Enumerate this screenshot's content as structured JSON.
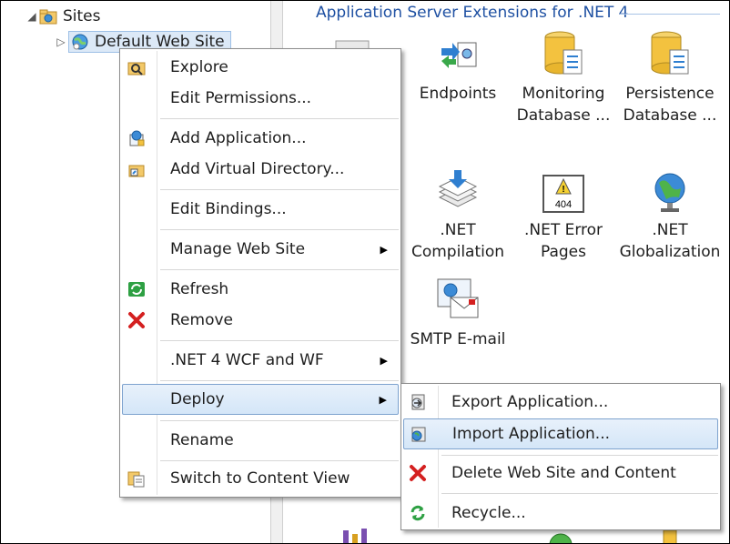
{
  "tree": {
    "sites_label": "Sites",
    "site_label": "Default Web Site"
  },
  "features": {
    "group_title": "Application Server Extensions for .NET 4",
    "items": [
      {
        "label_line1": "Endpoints",
        "label_line2": ""
      },
      {
        "label_line1": "Monitoring",
        "label_line2": "Database ..."
      },
      {
        "label_line1": "Persistence",
        "label_line2": "Database ..."
      },
      {
        "label_line1": ".NET",
        "label_line2": "Compilation"
      },
      {
        "label_line1": ".NET Error",
        "label_line2": "Pages"
      },
      {
        "label_line1": ".NET",
        "label_line2": "Globalization"
      },
      {
        "label_line1": "SMTP E-mail",
        "label_line2": ""
      }
    ],
    "error_icon_text": "404"
  },
  "context_menu": {
    "explore": "Explore",
    "edit_permissions": "Edit Permissions...",
    "add_application": "Add Application...",
    "add_virtual_directory": "Add Virtual Directory...",
    "edit_bindings": "Edit Bindings...",
    "manage_web_site": "Manage Web Site",
    "refresh": "Refresh",
    "remove": "Remove",
    "net4_wcf_wf": ".NET 4 WCF and WF",
    "deploy": "Deploy",
    "rename": "Rename",
    "switch_content_view": "Switch to Content View"
  },
  "deploy_submenu": {
    "export_application": "Export Application...",
    "import_application": "Import Application...",
    "delete_site_content": "Delete Web Site and Content",
    "recycle": "Recycle..."
  },
  "colors": {
    "group_title": "#1e50a2",
    "highlight_border": "#7da2ce",
    "remove_red": "#d42020",
    "refresh_green": "#2ea043"
  }
}
